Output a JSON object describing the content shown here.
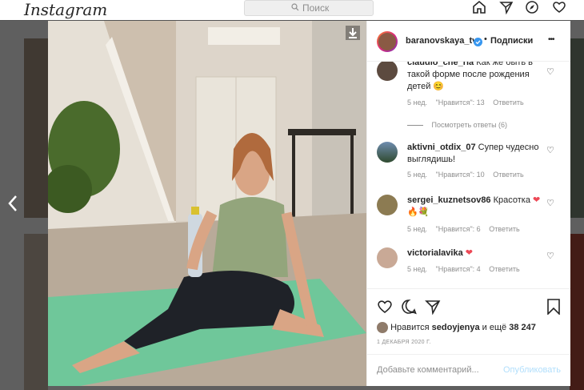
{
  "app": {
    "logo": "Instagram",
    "search_placeholder": "Поиск"
  },
  "post": {
    "username": "baranovskaya_tv",
    "verified": true,
    "follow_label": "Подписки",
    "more_label": "•••",
    "likes_prefix": "Нравится",
    "likes_user": "sedoyjenya",
    "likes_and": "и ещё",
    "likes_count": "38 247",
    "date": "1 ДЕКАБРЯ 2020 Г.",
    "comment_placeholder": "Добавьте комментарий...",
    "publish_label": "Опубликовать",
    "download_icon": "download-icon"
  },
  "comments": [
    {
      "username": "claudio_che_ria",
      "text": "Как же быть в такой форме после рождения детей",
      "emoji": "😊",
      "time": "5 нед.",
      "likes": "\"Нравится\": 13",
      "reply": "Ответить"
    },
    {
      "username": "aktivni_otdix_07",
      "text": "Супер чудесно выглядишь!",
      "time": "5 нед.",
      "likes": "\"Нравится\": 10",
      "reply": "Ответить"
    },
    {
      "username": "sergei_kuznetsov86",
      "text": "Красотка",
      "emoji": "❤",
      "emoji2": "🔥💐",
      "time": "5 нед.",
      "likes": "\"Нравится\": 6",
      "reply": "Ответить"
    },
    {
      "username": "victorialavika",
      "text": "",
      "emoji": "❤",
      "time": "5 нед.",
      "likes": "\"Нравится\": 4",
      "reply": "Ответить"
    }
  ],
  "view_replies": "Посмотреть ответы (6)",
  "colors": {
    "link": "#0095f6",
    "heart": "#ed4956",
    "publish_disabled": "#b2dffc"
  }
}
